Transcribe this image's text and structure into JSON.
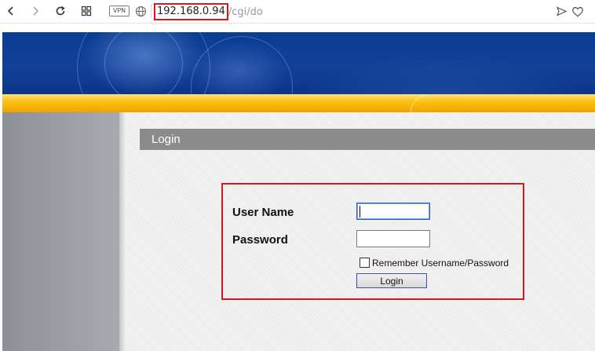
{
  "browser": {
    "address": {
      "host": "192.168.0.94",
      "path": "/cgi/do"
    },
    "vpn_label": "VPN",
    "icons": [
      "back-icon",
      "forward-icon",
      "reload-icon",
      "tabs-grid-icon",
      "globe-icon",
      "send-icon",
      "heart-icon"
    ]
  },
  "page": {
    "section_title": "Login",
    "form": {
      "username_label": "User Name",
      "password_label": "Password",
      "username_value": "",
      "password_value": "",
      "remember_label": "Remember Username/Password",
      "remember_checked": false,
      "login_button": "Login"
    }
  },
  "colors": {
    "banner_blue": "#0a3d93",
    "stripe_yellow": "#fcc114",
    "highlight_red": "#d9161e",
    "title_bar_gray": "#8b8b8b"
  }
}
